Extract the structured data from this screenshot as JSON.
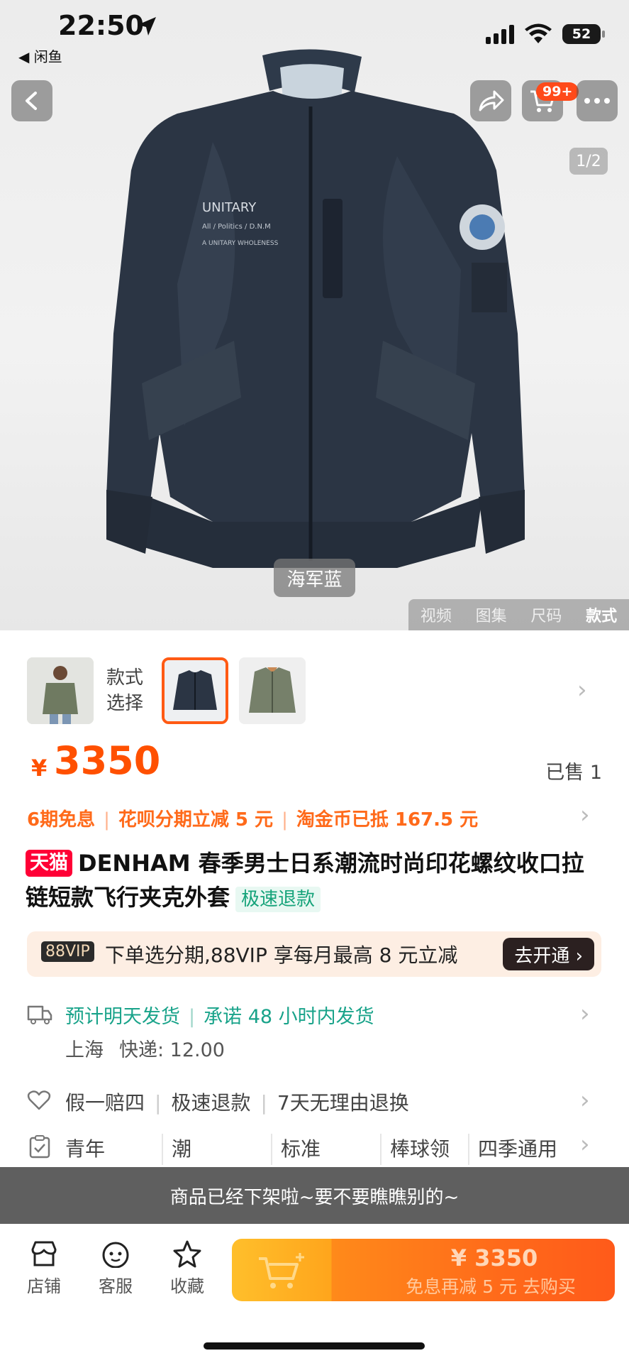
{
  "status_bar": {
    "time": "22:50",
    "back_app": "◀ 闲鱼",
    "battery": "52"
  },
  "hero": {
    "cart_badge": "99+",
    "page_indicator": "1/2",
    "color_label": "海军蓝",
    "media_tabs": [
      "视频",
      "图集",
      "尺码",
      "款式"
    ],
    "active_tab": "款式"
  },
  "variants": {
    "label_line1": "款式",
    "label_line2": "选择"
  },
  "price": {
    "symbol": "¥",
    "value": "3350",
    "sold": "已售 1"
  },
  "promos": [
    "6期免息",
    "花呗分期立减 5 元",
    "淘金币已抵 167.5 元"
  ],
  "product": {
    "badge": "天猫",
    "title": "DENHAM 春季男士日系潮流时尚印花螺纹收口拉链短款飞行夹克外套",
    "refund_tag": "极速退款"
  },
  "vip": {
    "tag": "88VIP",
    "text": "下单选分期,88VIP 享每月最高 8 元立减",
    "button": "去开通 ›"
  },
  "shipping": {
    "estimate": "预计明天发货",
    "promise": "承诺 48 小时内发货",
    "location": "上海",
    "fee": "快递: 12.00"
  },
  "guarantees": [
    "假一赔四",
    "极速退款",
    "7天无理由退换"
  ],
  "attributes": [
    "青年",
    "潮",
    "标准",
    "棒球领",
    "四季通用"
  ],
  "notice": "商品已经下架啦~要不要瞧瞧别的~",
  "bottom": {
    "shop": "店铺",
    "service": "客服",
    "favorite": "收藏",
    "buy_price": "¥ 3350",
    "buy_sub": "免息再减 5 元  去购买"
  },
  "colors": {
    "accent": "#ff5000",
    "green": "#19a38a",
    "tmall": "#ff0036"
  }
}
